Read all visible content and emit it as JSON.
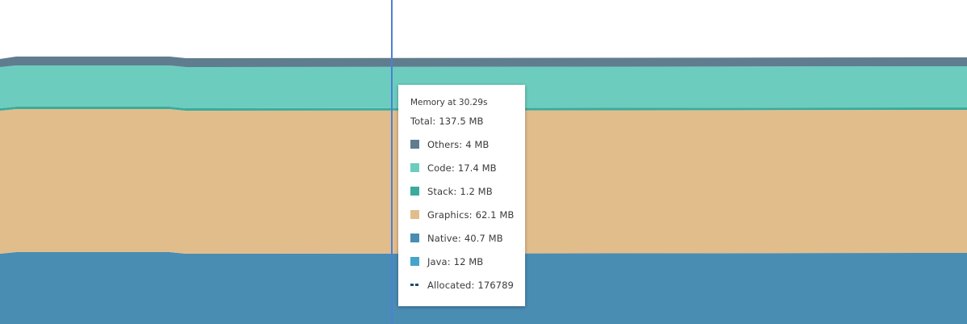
{
  "chart_data": {
    "type": "area",
    "stacking": "stacked",
    "cursor_time": "30.29s",
    "series": [
      {
        "name": "Others",
        "value_mb": 4,
        "color": "#607d8f"
      },
      {
        "name": "Code",
        "value_mb": 17.4,
        "color": "#6ccdbf"
      },
      {
        "name": "Stack",
        "value_mb": 1.2,
        "color": "#3bab9c"
      },
      {
        "name": "Graphics",
        "value_mb": 62.1,
        "color": "#e2bd8c"
      },
      {
        "name": "Native",
        "value_mb": 40.7,
        "color": "#4a8db3"
      },
      {
        "name": "Java",
        "value_mb": 12,
        "color": "#44a5c8"
      }
    ],
    "total_mb": 137.5,
    "allocated": 176789,
    "cursor_color": "#4d7fd6"
  },
  "tooltip": {
    "title": "Memory at 30.29s",
    "total_label": "Total:",
    "total_value": "137.5 MB",
    "rows": [
      {
        "label": "Others:",
        "value": "4 MB",
        "color": "#607d8f",
        "icon": "others-swatch"
      },
      {
        "label": "Code:",
        "value": "17.4 MB",
        "color": "#6ccdbf",
        "icon": "code-swatch"
      },
      {
        "label": "Stack:",
        "value": "1.2 MB",
        "color": "#3bab9c",
        "icon": "stack-swatch"
      },
      {
        "label": "Graphics:",
        "value": "62.1 MB",
        "color": "#e2bd8c",
        "icon": "graphics-swatch"
      },
      {
        "label": "Native:",
        "value": "40.7 MB",
        "color": "#4a8db3",
        "icon": "native-swatch"
      },
      {
        "label": "Java:",
        "value": "12 MB",
        "color": "#44a5c8",
        "icon": "java-swatch"
      }
    ],
    "allocated_label": "Allocated:",
    "allocated_value": "176789",
    "allocated_icon": "dashed-line-icon"
  }
}
